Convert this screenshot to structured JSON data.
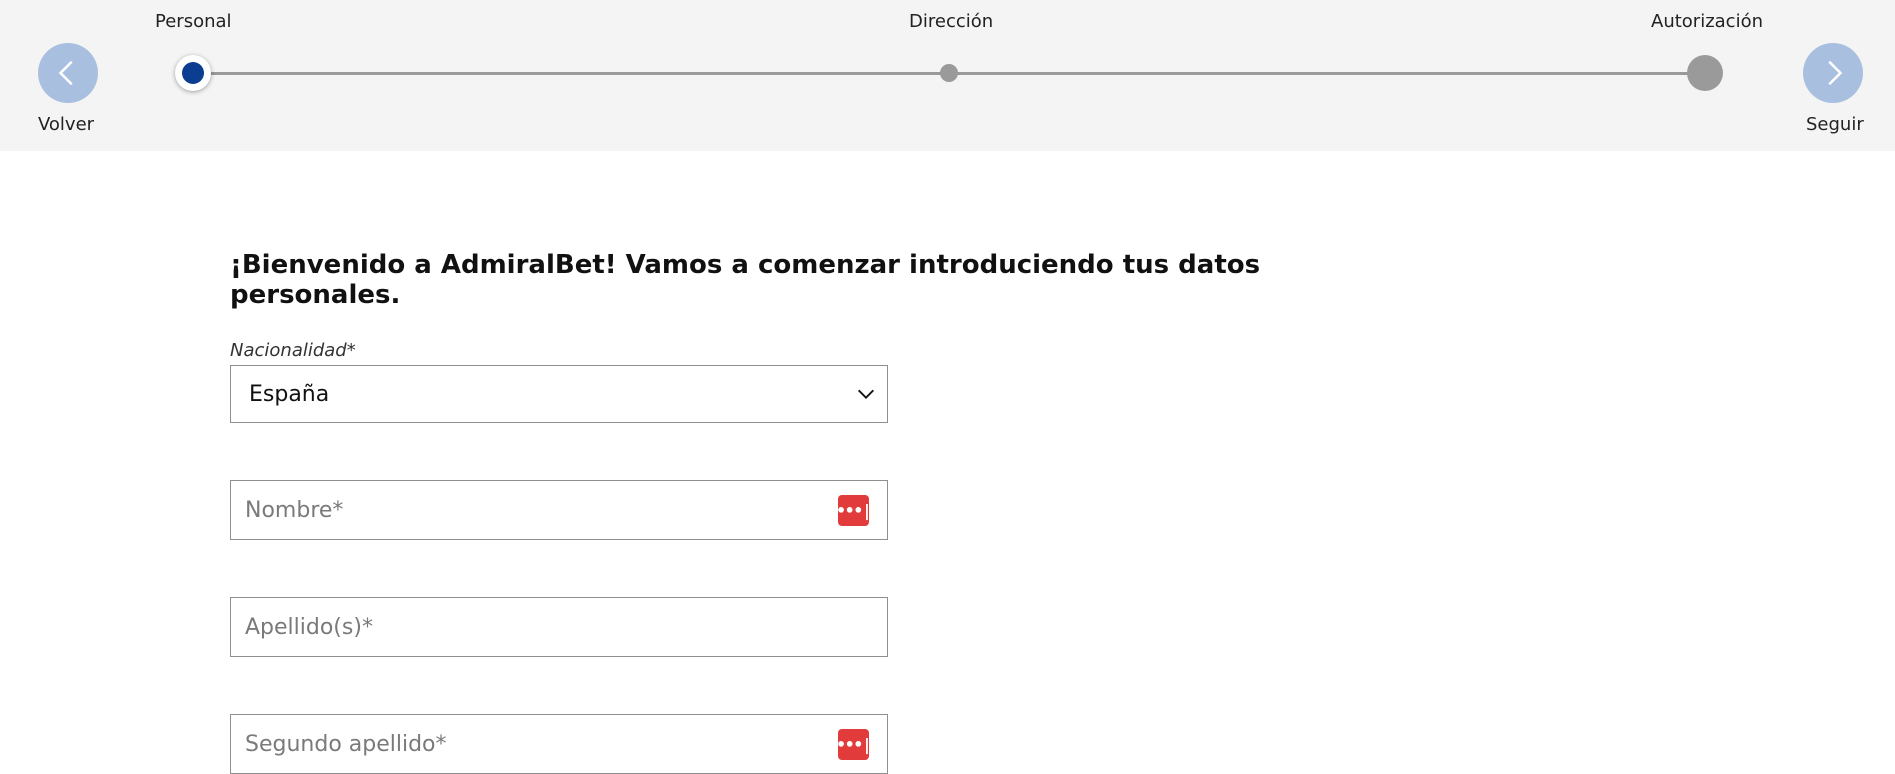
{
  "stepper": {
    "back_label": "Volver",
    "next_label": "Seguir",
    "steps": [
      {
        "label": "Personal",
        "state": "active"
      },
      {
        "label": "Dirección",
        "state": "pending"
      },
      {
        "label": "Autorización",
        "state": "pending"
      }
    ]
  },
  "form": {
    "welcome": "¡Bienvenido a AdmiralBet! Vamos a comenzar introduciendo tus datos personales.",
    "nationality_label": "Nacionalidad*",
    "nationality_value": "España",
    "first_name_placeholder": "Nombre*",
    "last_name_placeholder": "Apellido(s)*",
    "second_last_name_placeholder": "Segundo apellido*",
    "password_manager_icon": "•••|"
  },
  "colors": {
    "stepper_bg": "#f4f4f4",
    "nav_button": "#a9bfe0",
    "active_step": "#0b3d91",
    "inactive_step": "#9a9a9a",
    "password_icon": "#e23b3b"
  }
}
